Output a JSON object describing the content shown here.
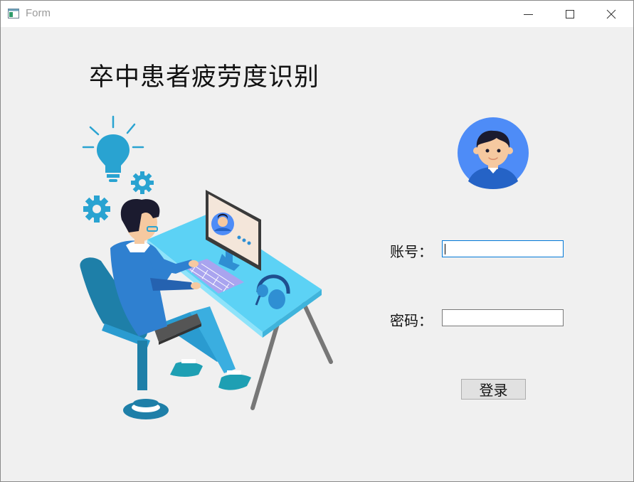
{
  "window": {
    "title": "Form"
  },
  "main": {
    "heading": "卒中患者疲劳度识别",
    "account_label": "账号：",
    "account_value": "",
    "password_label": "密码：",
    "password_value": "",
    "login_label": "登录"
  },
  "icons": {
    "app": "form-window-icon",
    "minimize": "minimize-icon",
    "maximize": "maximize-icon",
    "close": "close-icon",
    "avatar": "user-avatar-icon",
    "illustration": "person-at-computer-illustration"
  },
  "colors": {
    "accent": "#0078d7",
    "avatar_bg": "#4e8cf7",
    "illustration_blue": "#29a3d1"
  }
}
